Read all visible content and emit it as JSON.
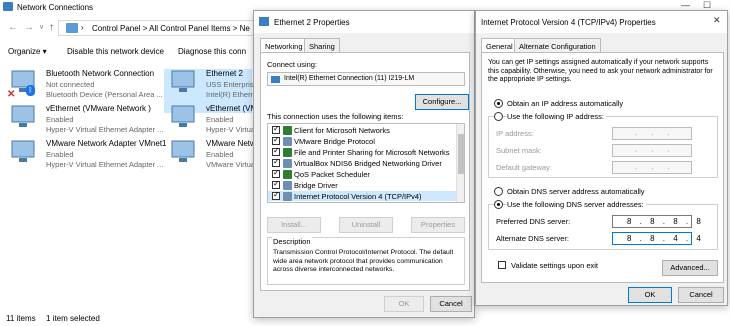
{
  "explorer": {
    "title": "Network Connections",
    "address": "Control Panel  >  All Control Panel Items  >  Ne",
    "commands": [
      "Organize ▾",
      "Disable this network device",
      "Diagnose this conn"
    ],
    "adapters": [
      {
        "name": "Bluetooth Network Connection",
        "status": "Not connected",
        "device": "Bluetooth Device (Personal Area ..."
      },
      {
        "name": "vEthernet (VMware Network )",
        "status": "Enabled",
        "device": "Hyper-V Virtual Ethernet Adapter ..."
      },
      {
        "name": "VMware Network Adapter VMnet1",
        "status": "Enabled",
        "device": "Hyper-V Virtual Ethernet Adapter ..."
      },
      {
        "name": "Ethernet 2",
        "status": "USS Enterprise",
        "device": "Intel(R) Etherne"
      },
      {
        "name": "vEthernet (VM",
        "status": "Enabled",
        "device": "Hyper-V Virtua"
      },
      {
        "name": "VMware Netw",
        "status": "Enabled",
        "device": "VMware Virtua"
      }
    ],
    "status_items": "11 items",
    "status_selected": "1 item selected"
  },
  "eth": {
    "title": "Ethernet 2 Properties",
    "tabs": [
      "Networking",
      "Sharing"
    ],
    "connect_using_label": "Connect using:",
    "adapter": "Intel(R) Ethernet Connection (11) I219-LM",
    "configure": "Configure...",
    "items_label": "This connection uses the following items:",
    "items": [
      "Client for Microsoft Networks",
      "VMware Bridge Protocol",
      "File and Printer Sharing for Microsoft Networks",
      "VirtualBox NDIS6 Bridged Networking Driver",
      "QoS Packet Scheduler",
      "Bridge Driver",
      "Internet Protocol Version 4 (TCP/IPv4)"
    ],
    "install": "Install...",
    "uninstall": "Uninstall",
    "properties": "Properties",
    "description_label": "Description",
    "description": "Transmission Control Protocol/Internet Protocol. The default wide area network protocol that provides communication across diverse interconnected networks.",
    "ok": "OK",
    "cancel": "Cancel"
  },
  "ipv4": {
    "title": "Internet Protocol Version 4 (TCP/IPv4) Properties",
    "tabs": [
      "General",
      "Alternate Configuration"
    ],
    "intro": "You can get IP settings assigned automatically if your network supports this capability. Otherwise, you need to ask your network administrator for the appropriate IP settings.",
    "auto_ip": "Obtain an IP address automatically",
    "manual_ip": "Use the following IP address:",
    "ip_address_label": "IP address:",
    "subnet_label": "Subnet mask:",
    "gateway_label": "Default gateway:",
    "auto_dns": "Obtain DNS server address automatically",
    "manual_dns": "Use the following DNS server addresses:",
    "preferred_label": "Preferred DNS server:",
    "preferred_value": "8 . 8 . 8 . 8",
    "alternate_label": "Alternate DNS server:",
    "alternate_value": "8 . 8 . 4 . 4",
    "validate": "Validate settings upon exit",
    "advanced": "Advanced...",
    "ok": "OK",
    "cancel": "Cancel"
  }
}
